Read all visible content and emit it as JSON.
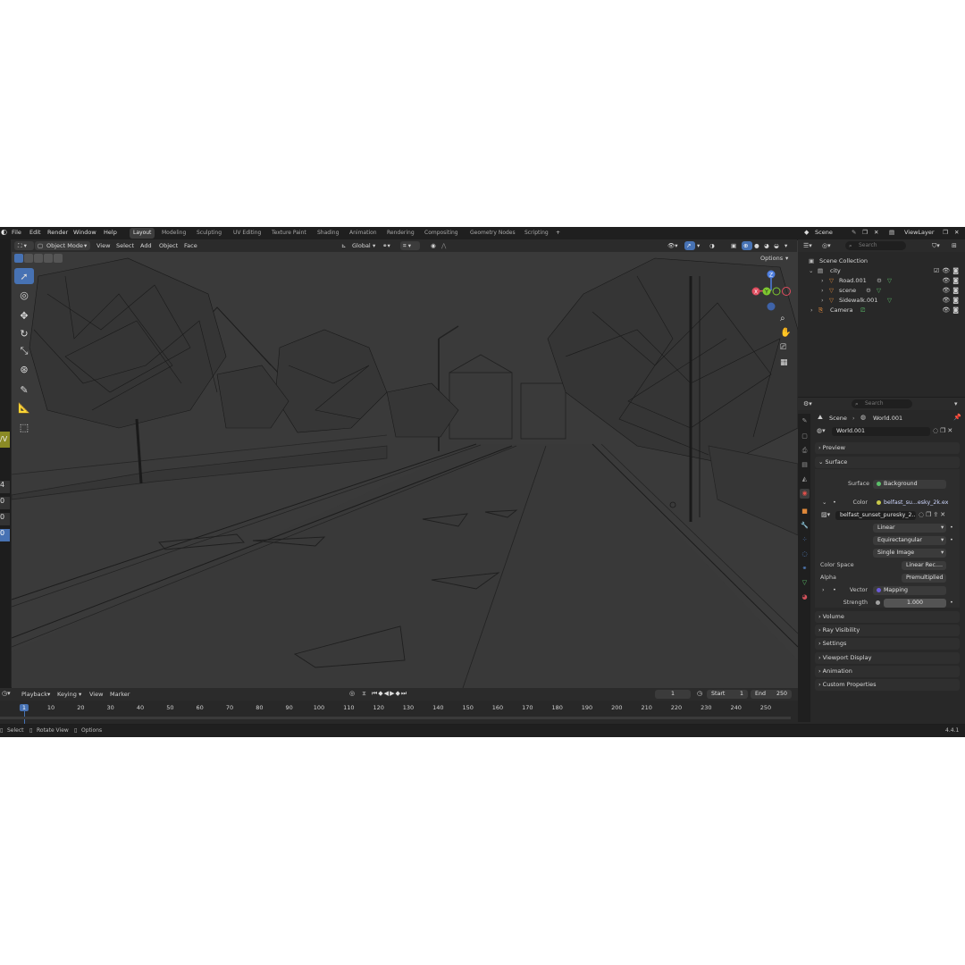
{
  "menu": {
    "items": [
      "File",
      "Edit",
      "Render",
      "Window",
      "Help"
    ],
    "workspaces": [
      "Layout",
      "Modeling",
      "Sculpting",
      "UV Editing",
      "Texture Paint",
      "Shading",
      "Animation",
      "Rendering",
      "Compositing",
      "Geometry Nodes",
      "Scripting"
    ],
    "add_workspace": "+",
    "scene_label": "Scene",
    "viewlayer_label": "ViewLayer"
  },
  "viewport": {
    "mode": "Object Mode",
    "menus": [
      "View",
      "Select",
      "Add",
      "Object",
      "Face"
    ],
    "transform_orientation": "Global",
    "options_label": "Options",
    "gizmo_axes": {
      "x": "X",
      "y": "Y",
      "z": "Z"
    }
  },
  "outliner": {
    "search_placeholder": "Search",
    "collection_root": "Scene Collection",
    "items": [
      {
        "name": "city"
      },
      {
        "name": "Road.001"
      },
      {
        "name": "scene"
      },
      {
        "name": "Sidewalk.001"
      },
      {
        "name": "Camera"
      }
    ]
  },
  "properties": {
    "search_placeholder": "Search",
    "breadcrumb": [
      "Scene",
      "World.001"
    ],
    "world_name": "World.001",
    "panels": {
      "preview": "Preview",
      "surface": "Surface",
      "volume": "Volume",
      "ray_visibility": "Ray Visibility",
      "settings": "Settings",
      "viewport_display": "Viewport Display",
      "animation": "Animation",
      "custom_properties": "Custom Properties"
    },
    "surface": {
      "surface_label": "Surface",
      "surface_value": "Background",
      "color_label": "Color",
      "color_value": "belfast_su...esky_2k.exr",
      "image_name": "belfast_sunset_puresky_2...",
      "interpolation": "Linear",
      "projection": "Equirectangular",
      "source": "Single Image",
      "color_space_label": "Color Space",
      "color_space_value": "Linear Rec....",
      "alpha_label": "Alpha",
      "alpha_value": "Premultiplied",
      "vector_label": "Vector",
      "vector_value": "Mapping",
      "strength_label": "Strength",
      "strength_value": "1.000"
    }
  },
  "timeline": {
    "menus": [
      "Playback",
      "Keying",
      "View",
      "Marker"
    ],
    "current_frame": "1",
    "start_label": "Start",
    "start_value": "1",
    "end_label": "End",
    "end_value": "250",
    "ticks": [
      "1",
      "10",
      "20",
      "30",
      "40",
      "50",
      "60",
      "70",
      "80",
      "90",
      "100",
      "110",
      "120",
      "130",
      "140",
      "150",
      "160",
      "170",
      "180",
      "190",
      "200",
      "210",
      "220",
      "230",
      "240",
      "250"
    ]
  },
  "statusbar": {
    "select": "Select",
    "rotate": "Rotate View",
    "options": "Options",
    "version": "4.4.1"
  },
  "left_edge_fragments": [
    "/V",
    "4",
    "0",
    "0",
    "0"
  ]
}
